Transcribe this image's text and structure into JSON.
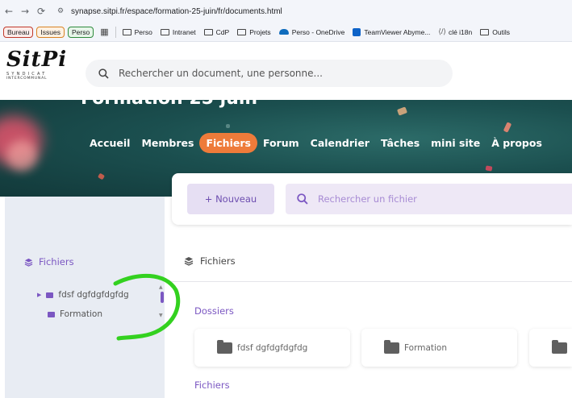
{
  "browser": {
    "url": "synapse.sitpi.fr/espace/formation-25-juin/fr/documents.html",
    "bookmarks_colored": [
      "Bureau",
      "Issues",
      "Perso"
    ],
    "bookmarks": [
      "Perso",
      "Intranet",
      "CdP",
      "Projets",
      "Perso - OneDrive",
      "TeamViewer Abyme...",
      "clé i18n",
      "Outils"
    ]
  },
  "header": {
    "logo": {
      "main": "SitPi",
      "sub1": "SYNDICAT",
      "sub2": "INTERCOMMUNAL"
    },
    "search_placeholder": "Rechercher un document, une personne..."
  },
  "banner": {
    "title": "Formation 25 juin",
    "nav": [
      "Accueil",
      "Membres",
      "Fichiers",
      "Forum",
      "Calendrier",
      "Tâches",
      "mini site",
      "À propos"
    ],
    "active_nav": "Fichiers"
  },
  "toolbar": {
    "new_label": "+ Nouveau",
    "file_search_placeholder": "Rechercher un fichier"
  },
  "sidebar": {
    "title": "Fichiers",
    "tree": [
      {
        "label": "fdsf dgfdgfdgfdg",
        "has_children": true
      },
      {
        "label": "Formation",
        "has_children": false
      }
    ]
  },
  "main": {
    "title": "Fichiers",
    "folders_section": "Dossiers",
    "folders": [
      "fdsf dgfdgfdgfdg",
      "Formation",
      ""
    ],
    "files_section": "Fichiers"
  },
  "colors": {
    "accent_purple": "#7b57c2",
    "active_nav_orange": "#ee7b3a",
    "annotation_green": "#33d11f",
    "banner_teal": "#1b4f4f"
  }
}
